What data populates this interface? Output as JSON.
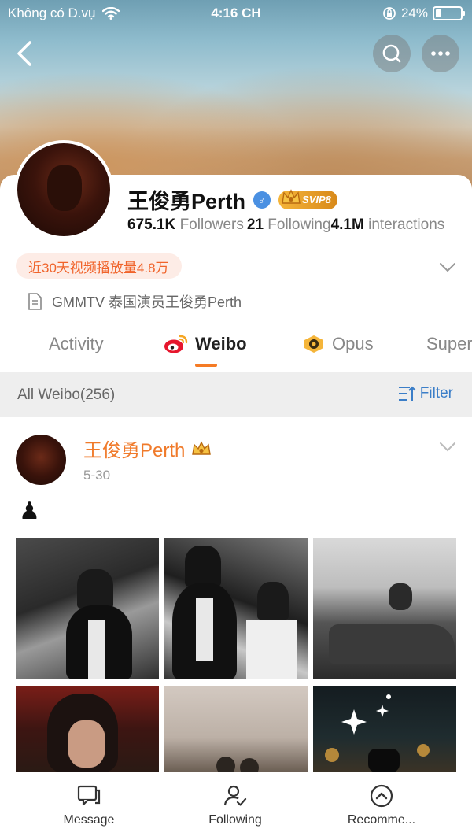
{
  "status_bar": {
    "carrier": "Không có D.vụ",
    "time": "4:16 CH",
    "battery_percent": "24%",
    "battery_level": 0.24
  },
  "profile": {
    "name": "王俊勇Perth",
    "gender_symbol": "♂",
    "vip_badge": "SVIP8",
    "followers_count": "675.1K",
    "followers_label": "Followers",
    "following_count": "21",
    "following_label": "Following",
    "interactions_count": "4.1M",
    "interactions_label": "interactions",
    "video_views": "近30天视频播放量4.8万",
    "bio": "GMMTV 泰国演员王俊勇Perth"
  },
  "tabs": [
    {
      "label": "Activity",
      "active": false
    },
    {
      "label": "Weibo",
      "active": true
    },
    {
      "label": "Opus",
      "active": false
    },
    {
      "label": "Super",
      "active": false
    }
  ],
  "filter_bar": {
    "title": "All Weibo(256)",
    "filter_label": "Filter"
  },
  "post": {
    "author": "王俊勇Perth",
    "date": "5-30",
    "text": "♟",
    "photo_count": 6
  },
  "bottom_nav": [
    {
      "label": "Message",
      "icon": "message-icon"
    },
    {
      "label": "Following",
      "icon": "following-icon"
    },
    {
      "label": "Recomme...",
      "icon": "recommend-icon"
    }
  ],
  "colors": {
    "accent_orange": "#f07a2a",
    "link_blue": "#3b7ec8",
    "pill_bg": "#fdece6",
    "pill_text": "#f0632a"
  }
}
